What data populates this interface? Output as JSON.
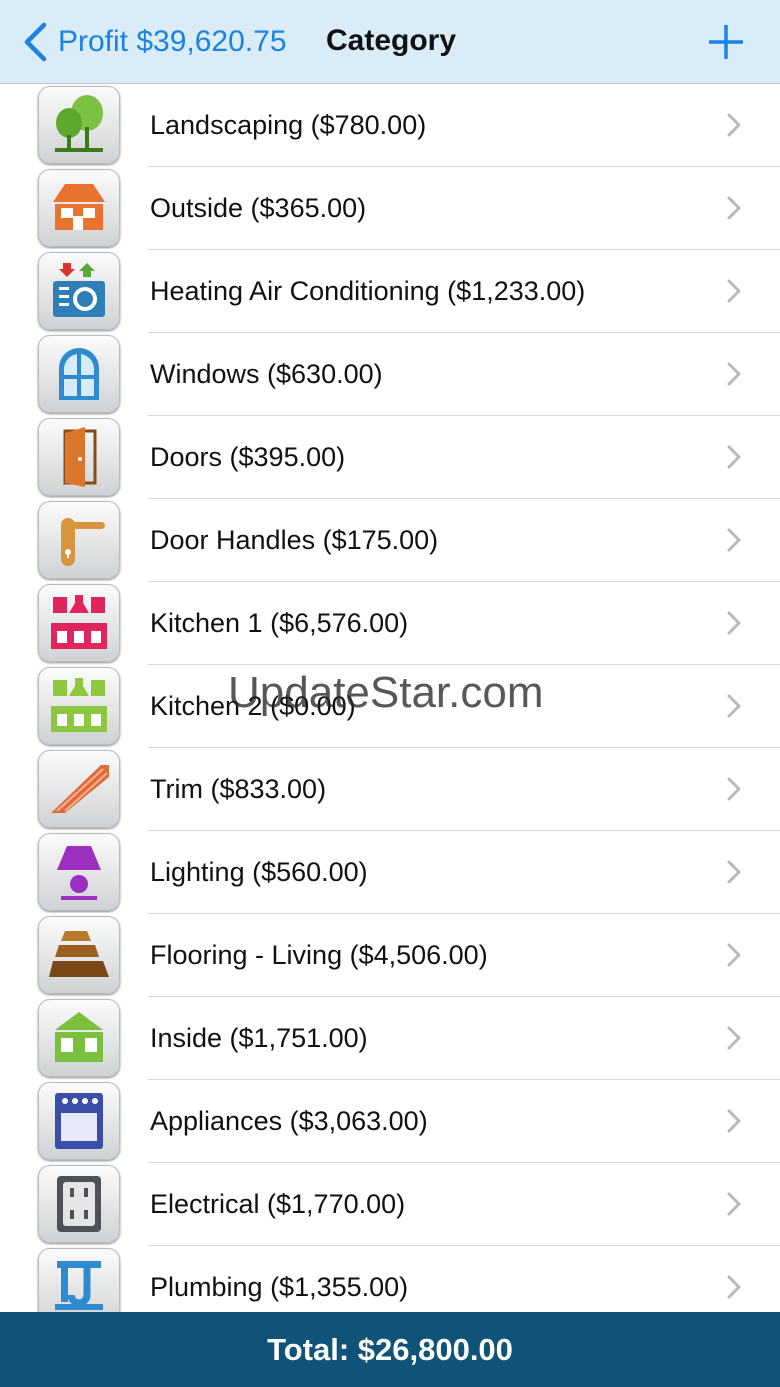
{
  "navbar": {
    "back_label": "Profit $39,620.75",
    "title": "Category",
    "accent_color": "#1a82e2"
  },
  "categories": [
    {
      "label": "Landscaping ($780.00)",
      "icon": "trees-icon"
    },
    {
      "label": "Outside ($365.00)",
      "icon": "house-outside-icon"
    },
    {
      "label": "Heating Air Conditioning ($1,233.00)",
      "icon": "hvac-icon"
    },
    {
      "label": "Windows ($630.00)",
      "icon": "window-icon"
    },
    {
      "label": "Doors ($395.00)",
      "icon": "door-icon"
    },
    {
      "label": "Door Handles ($175.00)",
      "icon": "door-handle-icon"
    },
    {
      "label": "Kitchen 1 ($6,576.00)",
      "icon": "kitchen-pink-icon"
    },
    {
      "label": "Kitchen 2 ($0.00)",
      "icon": "kitchen-green-icon"
    },
    {
      "label": "Trim ($833.00)",
      "icon": "trim-icon"
    },
    {
      "label": "Lighting ($560.00)",
      "icon": "lamp-icon"
    },
    {
      "label": "Flooring - Living ($4,506.00)",
      "icon": "flooring-icon"
    },
    {
      "label": "Inside ($1,751.00)",
      "icon": "house-inside-icon"
    },
    {
      "label": "Appliances ($3,063.00)",
      "icon": "stove-icon"
    },
    {
      "label": "Electrical ($1,770.00)",
      "icon": "outlet-icon"
    },
    {
      "label": "Plumbing ($1,355.00)",
      "icon": "plumbing-icon"
    }
  ],
  "footer": {
    "total_label": "Total: $26,800.00",
    "background_color": "#0f5478"
  },
  "watermark": "UpdateStar.com"
}
